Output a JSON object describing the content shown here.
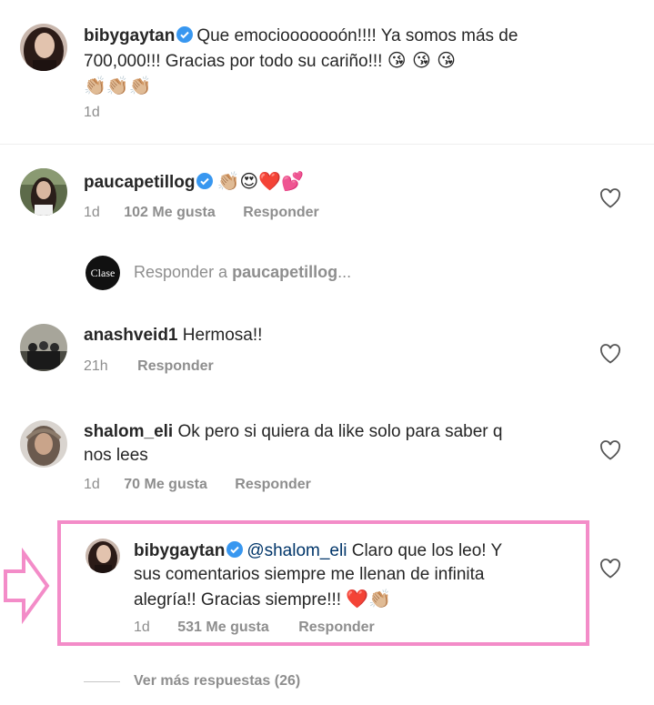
{
  "post_caption": {
    "username": "bibygaytan",
    "verified": true,
    "text": "Que emociooooooón!!!! Ya somos más de 700,000!!! Gracias por todo su cariño!!!",
    "emojis": "😘 😘 😘",
    "emojis_line2": "👏🏼👏🏼👏🏼",
    "time": "1d"
  },
  "comments": [
    {
      "username": "paucapetillog",
      "verified": true,
      "text": "",
      "emojis": "👏🏼😍❤️💕",
      "time": "1d",
      "likes": "102 Me gusta",
      "reply_label": "Responder"
    },
    {
      "username": "anashveid1",
      "verified": false,
      "text": "Hermosa!!",
      "time": "21h",
      "reply_label": "Responder"
    },
    {
      "username": "shalom_eli",
      "verified": false,
      "text_line1": "Ok pero si quiera da like solo para saber q",
      "text_line2": "nos lees",
      "time": "1d",
      "likes": "70 Me gusta",
      "reply_label": "Responder"
    }
  ],
  "reply_input": {
    "avatar_text": "Clase",
    "prefix": "Responder a ",
    "target": "paucapetillog",
    "suffix": "..."
  },
  "highlighted_reply": {
    "username": "bibygaytan",
    "verified": true,
    "mention": "@shalom_eli",
    "text_line1": " Claro que los leo! Y",
    "text_line2": "sus comentarios siempre me llenan de infinita",
    "text_line3": "alegría!! Gracias siempre!!!",
    "emojis": "❤️👏🏼",
    "time": "1d",
    "likes": "531 Me gusta",
    "reply_label": "Responder"
  },
  "more_replies": "Ver más respuestas (26)",
  "colors": {
    "verified_blue": "#3897f0",
    "highlight_pink": "#f38cc8",
    "meta_gray": "#8e8e8e"
  }
}
